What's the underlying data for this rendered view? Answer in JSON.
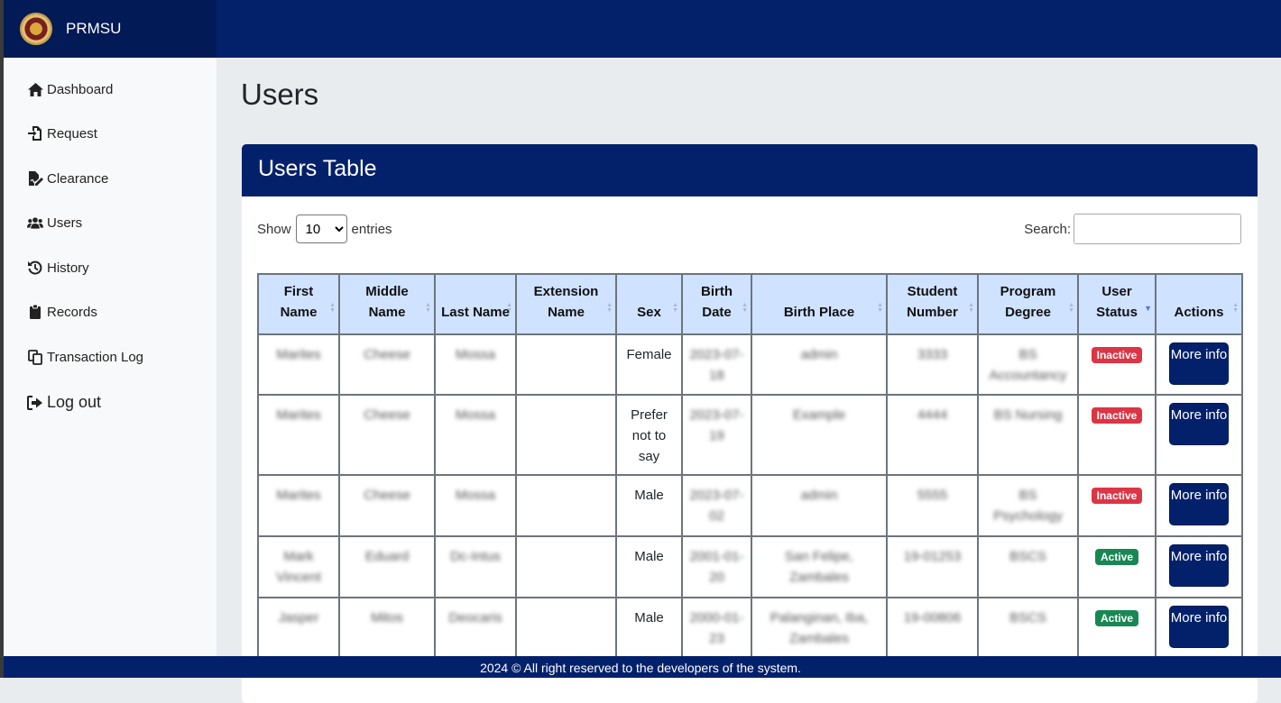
{
  "app": {
    "brand": "PRMSU"
  },
  "sidebar": {
    "items": [
      {
        "label": "Dashboard",
        "icon": "home-icon"
      },
      {
        "label": "Request",
        "icon": "file-import-icon"
      },
      {
        "label": "Clearance",
        "icon": "file-signature-icon"
      },
      {
        "label": "Users",
        "icon": "users-icon"
      },
      {
        "label": "History",
        "icon": "history-icon"
      },
      {
        "label": "Records",
        "icon": "clipboard-icon"
      },
      {
        "label": "Transaction Log",
        "icon": "copy-icon"
      },
      {
        "label": "Log out",
        "icon": "sign-out-icon"
      }
    ]
  },
  "page": {
    "title": "Users"
  },
  "card": {
    "title": "Users Table"
  },
  "controls": {
    "show_label": "Show",
    "entries_label": "entries",
    "entries_value": "10",
    "search_label": "Search:",
    "search_value": ""
  },
  "table": {
    "headers": [
      "First Name",
      "Middle Name",
      "Last Name",
      "Extension Name",
      "Sex",
      "Birth Date",
      "Birth Place",
      "Student Number",
      "Program Degree",
      "User Status",
      "Actions"
    ],
    "rows": [
      {
        "first": "Marites",
        "middle": "Cheese",
        "last": "Mossa",
        "ext": "",
        "sex": "Female",
        "birth_date": "2023-07-18",
        "birth_place": "admin",
        "student_no": "3333",
        "program": "BS Accountancy",
        "status": "Inactive",
        "action": "More info"
      },
      {
        "first": "Marites",
        "middle": "Cheese",
        "last": "Mossa",
        "ext": "",
        "sex": "Prefer not to say",
        "birth_date": "2023-07-19",
        "birth_place": "Example",
        "student_no": "4444",
        "program": "BS Nursing",
        "status": "Inactive",
        "action": "More info"
      },
      {
        "first": "Marites",
        "middle": "Cheese",
        "last": "Mossa",
        "ext": "",
        "sex": "Male",
        "birth_date": "2023-07-02",
        "birth_place": "admin",
        "student_no": "5555",
        "program": "BS Psychology",
        "status": "Inactive",
        "action": "More info"
      },
      {
        "first": "Mark Vincent",
        "middle": "Eduard",
        "last": "Dc-Intus",
        "ext": "",
        "sex": "Male",
        "birth_date": "2001-01-20",
        "birth_place": "San Felipe, Zambales",
        "student_no": "19-01253",
        "program": "BSCS",
        "status": "Active",
        "action": "More info"
      },
      {
        "first": "Jasper",
        "middle": "Mitos",
        "last": "Deocaris",
        "ext": "",
        "sex": "Male",
        "birth_date": "2000-01-23",
        "birth_place": "Palanginan, Iba, Zambales",
        "student_no": "19-00806",
        "program": "BSCS",
        "status": "Active",
        "action": "More info"
      }
    ]
  },
  "footer": {
    "text": "2024 © All right reserved to the developers of the system."
  }
}
